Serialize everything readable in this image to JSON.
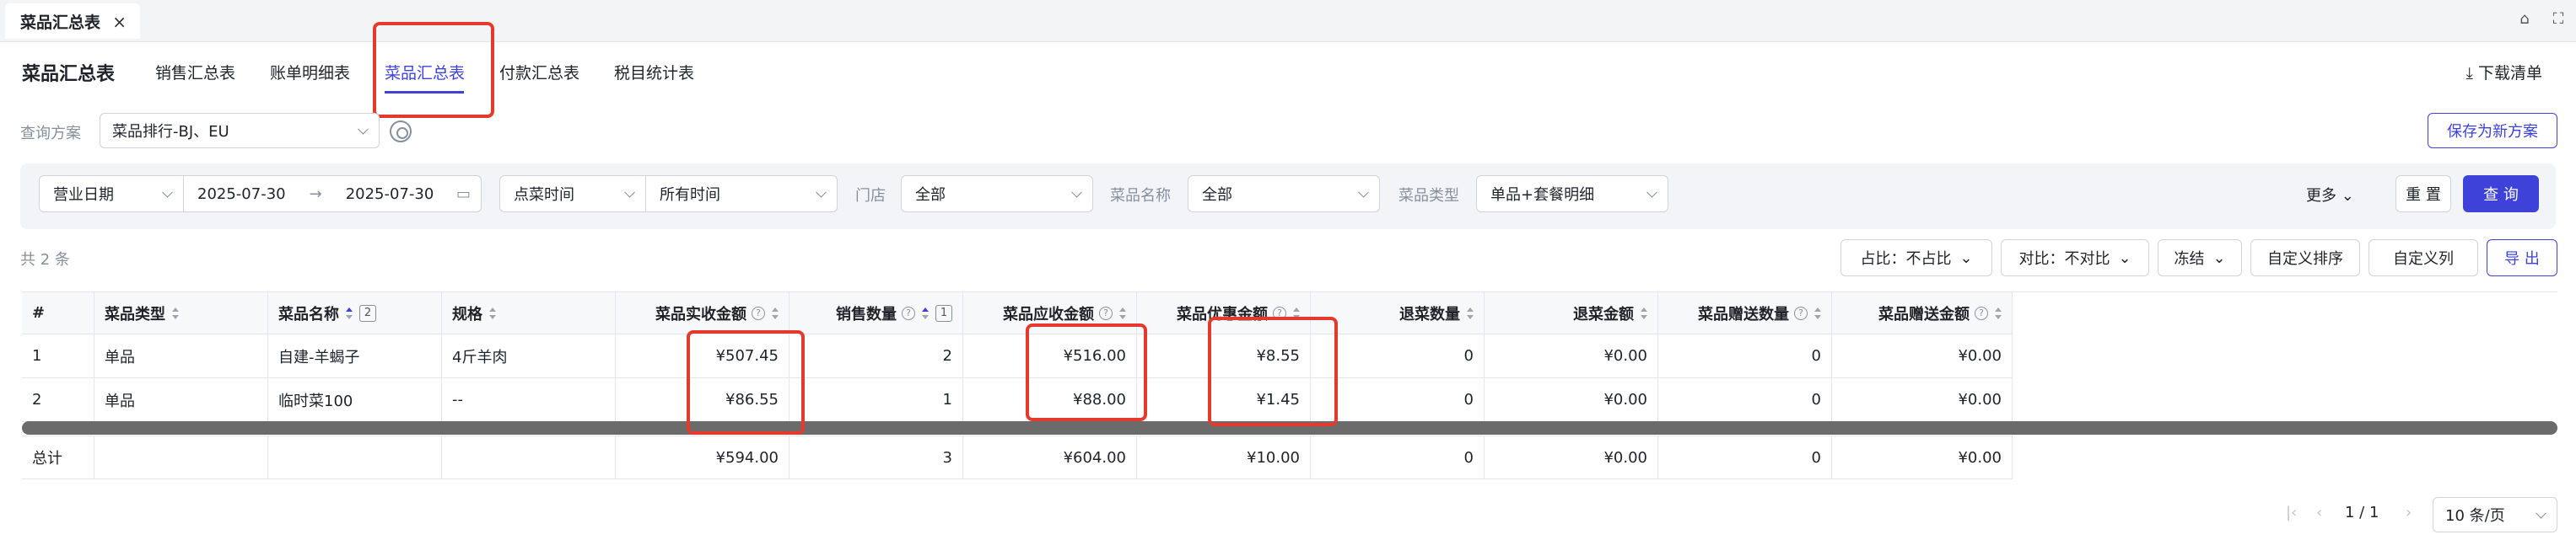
{
  "window": {
    "tab_label": "菜品汇总表",
    "close_glyph": "×"
  },
  "nav": {
    "title": "菜品汇总表",
    "tabs": [
      "销售汇总表",
      "账单明细表",
      "菜品汇总表",
      "付款汇总表",
      "税目统计表"
    ],
    "active_tab": 2,
    "download_label": "下载清单"
  },
  "scheme": {
    "label": "查询方案",
    "value": "菜品排行-BJ、EU",
    "save_label": "保存为新方案"
  },
  "filters": {
    "date_type": "营业日期",
    "date_start": "2025-07-30",
    "date_arrow": "→",
    "date_end": "2025-07-30",
    "time_type": "点菜时间",
    "time_value": "所有时间",
    "store_label": "门店",
    "store_value": "全部",
    "dish_name_label": "菜品名称",
    "dish_name_value": "全部",
    "dish_type_label": "菜品类型",
    "dish_type_value": "单品+套餐明细",
    "more_label": "更多",
    "reset_label": "重 置",
    "query_label": "查 询"
  },
  "toolbar": {
    "count_text": "共 2 条",
    "ratio_label": "占比：不占比",
    "compare_label": "对比：不对比",
    "freeze_label": "冻结",
    "custom_sort_label": "自定义排序",
    "custom_cols_label": "自定义列",
    "export_label": "导 出"
  },
  "table": {
    "headers": [
      "#",
      "菜品类型",
      "菜品名称",
      "规格",
      "菜品实收金额",
      "销售数量",
      "菜品应收金额",
      "菜品优惠金额",
      "退菜数量",
      "退菜金额",
      "菜品赠送数量",
      "菜品赠送金额"
    ],
    "name_sort_badge": "2",
    "qty_sort_badge": "1",
    "rows": [
      [
        "1",
        "单品",
        "自建-羊蝎子",
        "4斤羊肉",
        "¥507.45",
        "2",
        "¥516.00",
        "¥8.55",
        "0",
        "¥0.00",
        "0",
        "¥0.00"
      ],
      [
        "2",
        "单品",
        "临时菜100",
        "--",
        "¥86.55",
        "1",
        "¥88.00",
        "¥1.45",
        "0",
        "¥0.00",
        "0",
        "¥0.00"
      ]
    ],
    "total": [
      "总计",
      "",
      "",
      "",
      "¥594.00",
      "3",
      "¥604.00",
      "¥10.00",
      "0",
      "¥0.00",
      "0",
      "¥0.00"
    ]
  },
  "pagination": {
    "page_text": "1 / 1",
    "page_size": "10 条/页"
  },
  "colors": {
    "accent": "#3e42d9",
    "highlight": "#e53a2b"
  }
}
